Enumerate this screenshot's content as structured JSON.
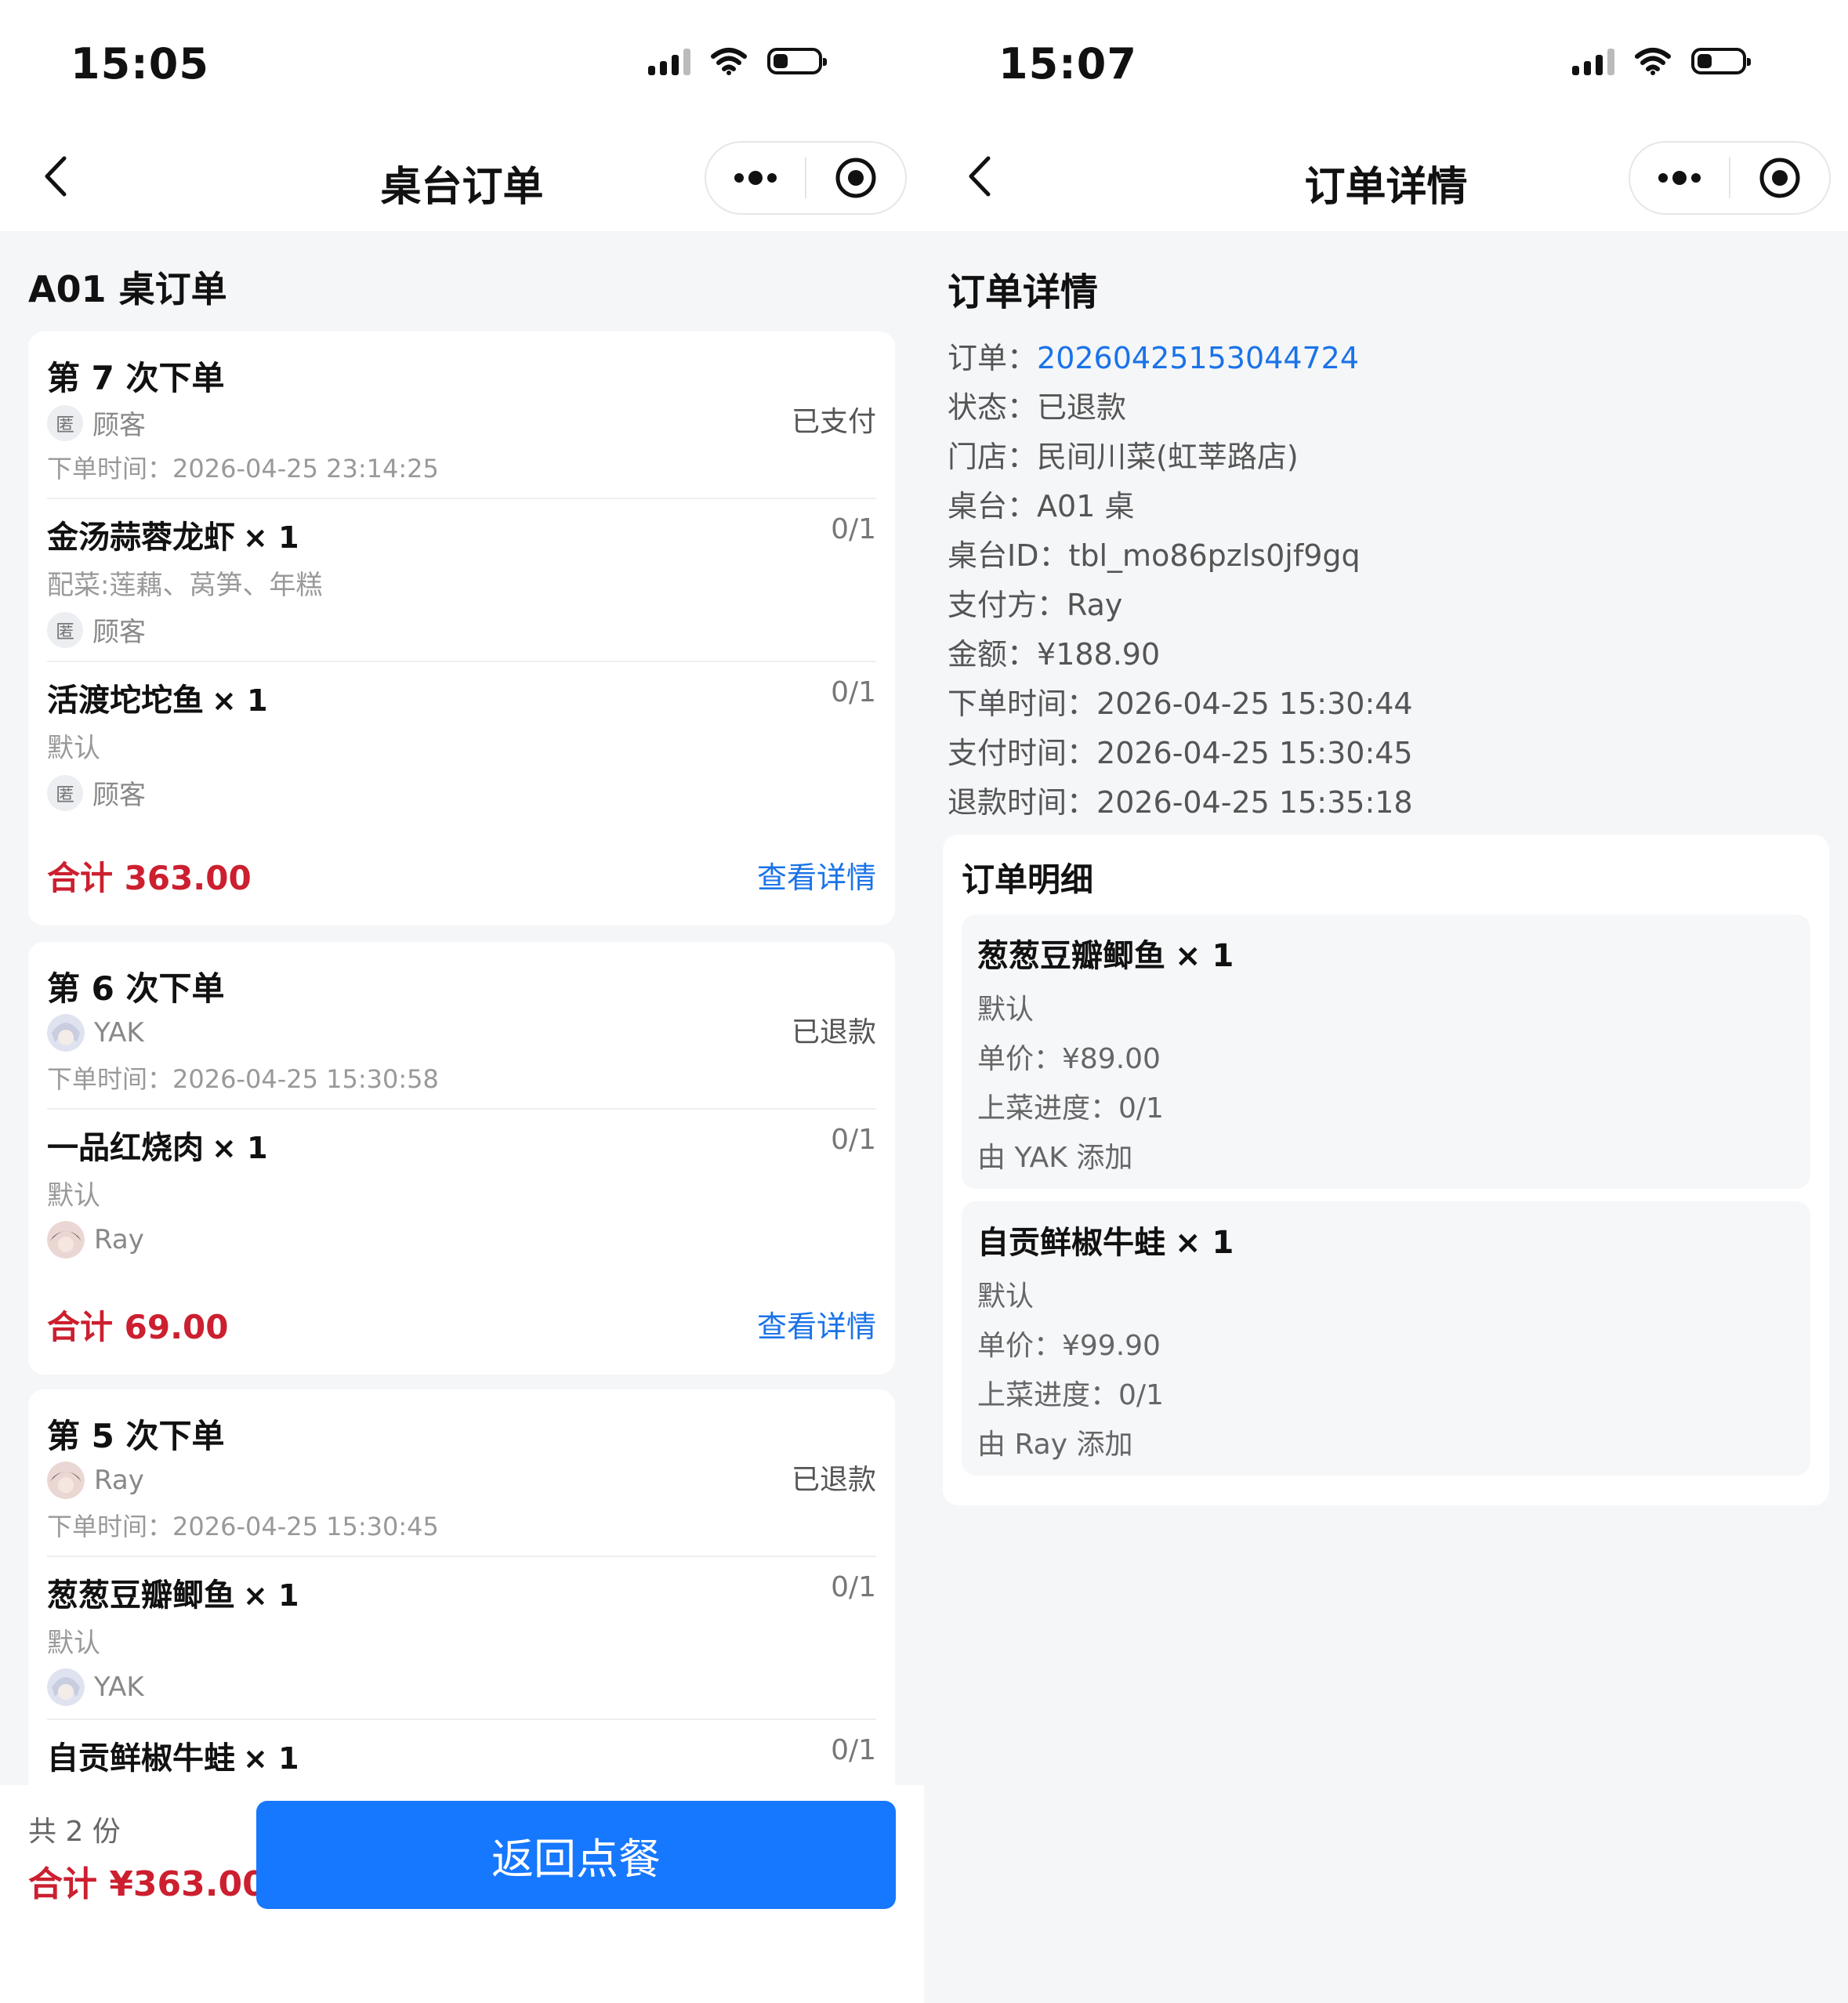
{
  "left": {
    "status_time": "15:05",
    "nav_title": "桌台订单",
    "page_title": "A01 桌订单",
    "orders": [
      {
        "title": "第 7 次下单",
        "status": "已支付",
        "user": "顾客",
        "time": "下单时间：2026-04-25 23:14:25",
        "items": [
          {
            "name": "金汤蒜蓉龙虾",
            "qty": "× 1",
            "progress": "0/1",
            "spec": "配菜:莲藕、莴笋、年糕",
            "user": "顾客"
          },
          {
            "name": "活渡坨坨鱼",
            "qty": "× 1",
            "progress": "0/1",
            "spec": "默认",
            "user": "顾客"
          }
        ],
        "total": "合计 363.00",
        "link": "查看详情"
      },
      {
        "title": "第 6 次下单",
        "status": "已退款",
        "user": "YAK",
        "time": "下单时间：2026-04-25 15:30:58",
        "items": [
          {
            "name": "一品红烧肉",
            "qty": "× 1",
            "progress": "0/1",
            "spec": "默认",
            "user": "Ray"
          }
        ],
        "total": "合计 69.00",
        "link": "查看详情"
      },
      {
        "title": "第 5 次下单",
        "status": "已退款",
        "user": "Ray",
        "time": "下单时间：2026-04-25 15:30:45",
        "items": [
          {
            "name": "葱葱豆瓣鲫鱼",
            "qty": "× 1",
            "progress": "0/1",
            "spec": "默认",
            "user": "YAK"
          },
          {
            "name": "自贡鲜椒牛蛙",
            "qty": "× 1",
            "progress": "0/1"
          }
        ]
      }
    ],
    "anon_badge": "匿",
    "bottom": {
      "count": "共 2 份",
      "total": "合计 ¥363.00",
      "button": "返回点餐"
    }
  },
  "right": {
    "status_time": "15:07",
    "nav_title": "订单详情",
    "page_title": "订单详情",
    "info": [
      {
        "label": "订单：",
        "value": "20260425153044724",
        "link": true
      },
      {
        "label": "状态：",
        "value": "已退款"
      },
      {
        "label": "门店：",
        "value": "民间川菜(虹莘路店)"
      },
      {
        "label": "桌台：",
        "value": "A01 桌"
      },
      {
        "label": "桌台ID：",
        "value": "tbl_mo86pzls0jf9gq"
      },
      {
        "label": "支付方：",
        "value": "Ray"
      },
      {
        "label": "金额：",
        "value": "¥188.90"
      },
      {
        "label": "下单时间：",
        "value": "2026-04-25 15:30:44"
      },
      {
        "label": "支付时间：",
        "value": "2026-04-25 15:30:45"
      },
      {
        "label": "退款时间：",
        "value": "2026-04-25 15:35:18"
      }
    ],
    "detail_head": "订单明细",
    "dishes": [
      {
        "name": "葱葱豆瓣鲫鱼",
        "qty": "× 1",
        "spec": "默认",
        "price": "单价：¥89.00",
        "progress": "上菜进度：0/1",
        "added_by": "由 YAK 添加"
      },
      {
        "name": "自贡鲜椒牛蛙",
        "qty": "× 1",
        "spec": "默认",
        "price": "单价：¥99.90",
        "progress": "上菜进度：0/1",
        "added_by": "由 Ray 添加"
      }
    ]
  },
  "colors": {
    "accent_blue": "#1677ff",
    "link_blue": "#1a73e8",
    "total_red": "#cc1f2f"
  },
  "icons": [
    "back-icon",
    "more-dots-icon",
    "record-target-icon",
    "signal-icon",
    "wifi-icon",
    "battery-icon",
    "anonymous-icon",
    "avatar-yak",
    "avatar-ray"
  ]
}
